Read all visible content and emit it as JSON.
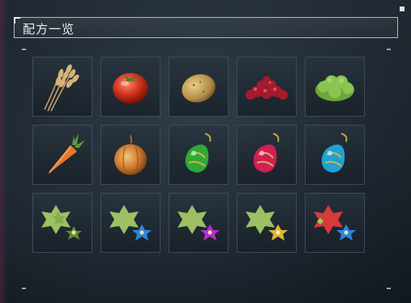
{
  "window": {
    "title": "配方一览"
  },
  "colors": {
    "border": "#aeb8bf",
    "cell_border": "#3e4b57",
    "background": "#1b252f"
  },
  "recipes": [
    {
      "icon": "wheat-icon"
    },
    {
      "icon": "tomato-icon"
    },
    {
      "icon": "potato-icon"
    },
    {
      "icon": "berries-icon"
    },
    {
      "icon": "lettuce-icon"
    },
    {
      "icon": "carrot-icon"
    },
    {
      "icon": "onion-icon"
    },
    {
      "icon": "green-gem-pendant-icon"
    },
    {
      "icon": "red-gem-pendant-icon"
    },
    {
      "icon": "blue-gem-pendant-icon"
    },
    {
      "icon": "flower-green-icon"
    },
    {
      "icon": "flower-blue-icon"
    },
    {
      "icon": "flower-purple-icon"
    },
    {
      "icon": "flower-yellow-icon"
    },
    {
      "icon": "flower-red-icon"
    }
  ]
}
